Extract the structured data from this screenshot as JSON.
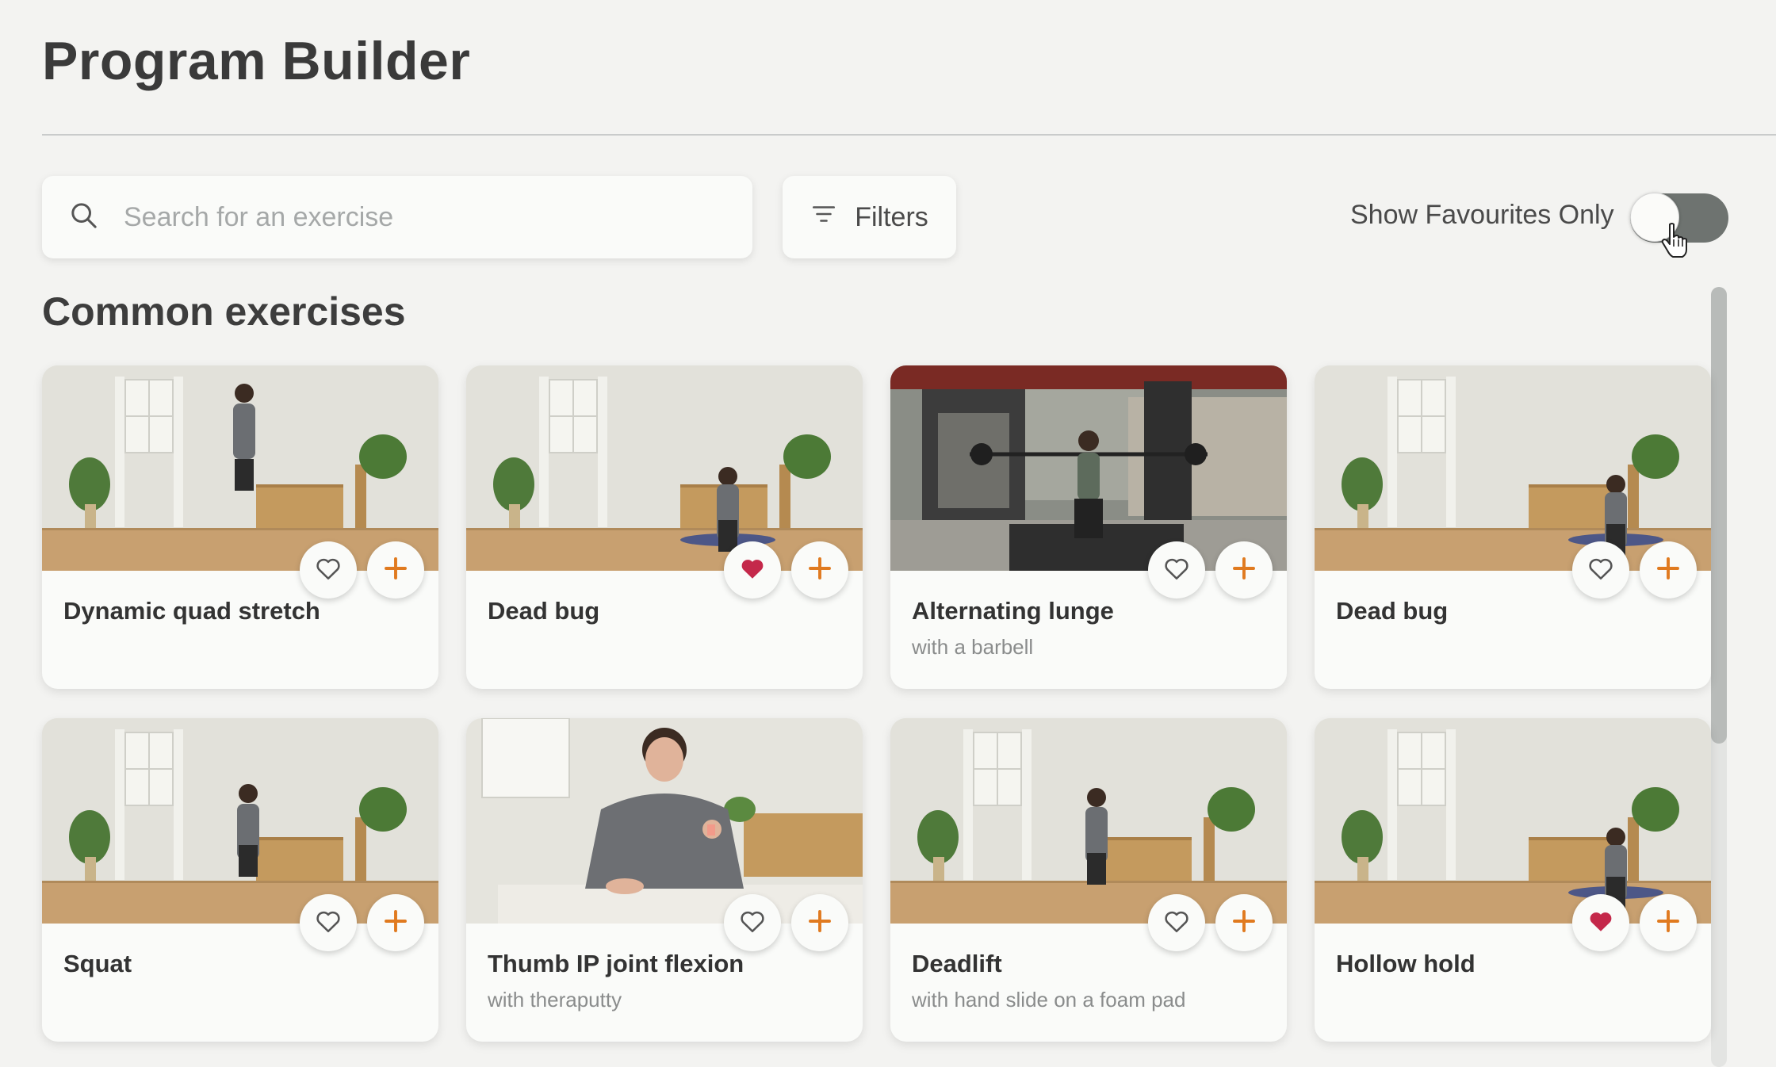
{
  "page": {
    "title": "Program Builder",
    "section_title": "Common exercises"
  },
  "toolbar": {
    "search_placeholder": "Search for an exercise",
    "filters_label": "Filters",
    "favourites_label": "Show Favourites Only",
    "favourites_only": false
  },
  "colors": {
    "accent_orange": "#e07a1f",
    "favourite_red": "#c4284a",
    "toggle_track": "#6e7370"
  },
  "exercises": [
    {
      "name": "Dynamic quad stretch",
      "subtitle": "",
      "favourite": false,
      "scene": "studio"
    },
    {
      "name": "Dead bug",
      "subtitle": "",
      "favourite": true,
      "scene": "studio"
    },
    {
      "name": "Alternating lunge",
      "subtitle": "with a barbell",
      "favourite": false,
      "scene": "outdoor"
    },
    {
      "name": "Dead bug",
      "subtitle": "",
      "favourite": false,
      "scene": "studio"
    },
    {
      "name": "Squat",
      "subtitle": "",
      "favourite": false,
      "scene": "studio"
    },
    {
      "name": "Thumb IP joint flexion",
      "subtitle": "with theraputty",
      "favourite": false,
      "scene": "table"
    },
    {
      "name": "Deadlift",
      "subtitle": "with hand slide on a foam pad",
      "favourite": false,
      "scene": "studio"
    },
    {
      "name": "Hollow hold",
      "subtitle": "",
      "favourite": true,
      "scene": "studio"
    }
  ],
  "icons": {
    "search": "search-icon",
    "filters": "filter-icon",
    "favourite": "heart-icon",
    "add": "plus-icon",
    "cursor": "hand-pointer-icon"
  }
}
